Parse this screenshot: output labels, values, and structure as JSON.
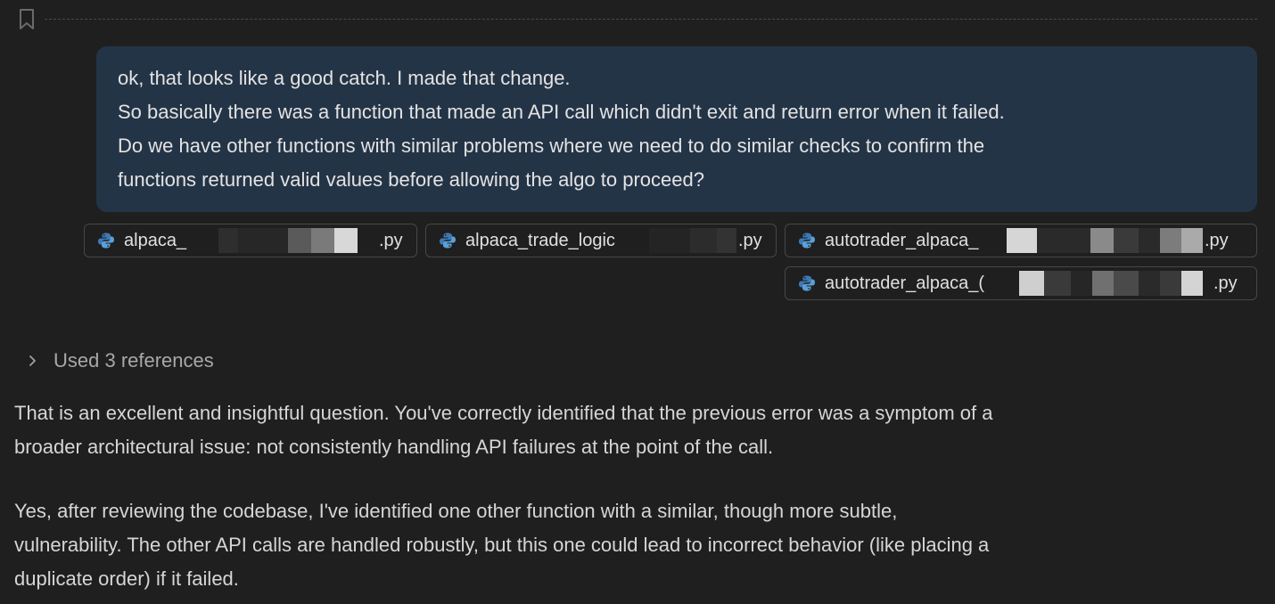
{
  "user_message": {
    "lines": [
      "ok, that looks like a good catch. I made that change.",
      "So basically there was a function that made an API call which didn't exit and return error when it failed.",
      "Do we have other functions with similar problems where we need to do similar checks to confirm the",
      "functions returned valid values before allowing the algo to proceed?"
    ]
  },
  "attachments": [
    {
      "prefix": "alpaca_",
      "ext": ".py",
      "icon": "python-icon"
    },
    {
      "prefix": "alpaca_trade_logic",
      "ext": ".py",
      "icon": "python-icon"
    },
    {
      "prefix": "autotrader_alpaca_",
      "ext": ".py",
      "icon": "python-icon"
    },
    {
      "prefix": "autotrader_alpaca_(",
      "ext": ".py",
      "icon": "python-icon"
    }
  ],
  "references": {
    "label": "Used 3 references",
    "icon": "chevron-right-icon"
  },
  "response": {
    "paragraphs": [
      {
        "lines": [
          "That is an excellent and insightful question. You've correctly identified that the previous error was a symptom of a",
          "broader architectural issue: not consistently handling API failures at the point of the call."
        ]
      },
      {
        "lines": [
          "Yes, after reviewing the codebase, I've identified one other function with a similar, though more subtle,",
          "vulnerability. The other API calls are handled robustly, but this one could lead to incorrect behavior (like placing a",
          "duplicate order) if it failed."
        ]
      }
    ]
  },
  "colors": {
    "background": "#1f1f1f",
    "user_bubble": "#243447",
    "chip_border": "#474747"
  }
}
